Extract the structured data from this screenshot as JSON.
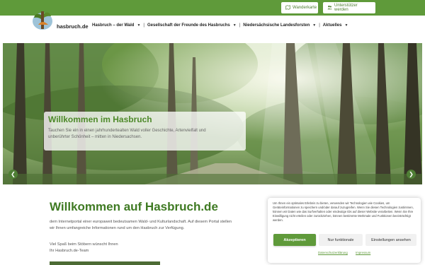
{
  "topbar": {
    "map_label": "Wanderkarte",
    "support_label": "Unterstützer werden"
  },
  "header": {
    "logo_text": "hasbruch.de"
  },
  "nav": {
    "items": [
      {
        "label": "Hasbruch – der Wald"
      },
      {
        "label": "Gesellschaft der Freunde des Hasbruchs"
      },
      {
        "label": "Niedersächsische Landesforsten"
      },
      {
        "label": "Aktuelles"
      }
    ]
  },
  "hero": {
    "title": "Willkommen im Hasbruch",
    "text_line1": "Tauchen Sie ein in einen jahrhundertealten Wald voller Geschichte, Artenvielfalt und",
    "text_line2": "unberührter Schönheit – mitten in Niedersachsen.",
    "prev_symbol": "❮",
    "next_symbol": "❯"
  },
  "main": {
    "title": "Willkommen auf Hasbruch.de",
    "text_line1": "dem Internetportal einer europaweit bedeutsamen Wald- und Kulturlandschaft. Auf diesem Portal stellen",
    "text_line2": "wir Ihnen umfangreiche Informationen rund um den Hasbruch zur Verfügung.",
    "greeting": "Viel Spaß beim Stöbern wünscht Ihnen",
    "signature": "Ihr Hasbruch.de-Team"
  },
  "cookie": {
    "text": "Um Ihnen ein optimales Erlebnis zu bieten, verwenden wir Technologien wie Cookies, um Geräteinformationen zu speichern und/oder darauf zuzugreifen. Wenn Sie diesen Technologien zustimmen, können wir Daten wie das Surfverhalten oder eindeutige IDs auf dieser Website verarbeiten. Wenn Sie Ihre Einwilligung nicht erteilen oder zurückziehen, können bestimmte Merkmale und Funktionen beeinträchtigt werden.",
    "accept_label": "Akzeptieren",
    "functional_label": "Nur funktionale",
    "settings_label": "Einstellungen ansehen",
    "privacy_label": "Datenschutzerklärung",
    "imprint_label": "Impressum"
  },
  "colors": {
    "brand_green": "#5f9a3a",
    "title_green": "#3f7a23"
  }
}
